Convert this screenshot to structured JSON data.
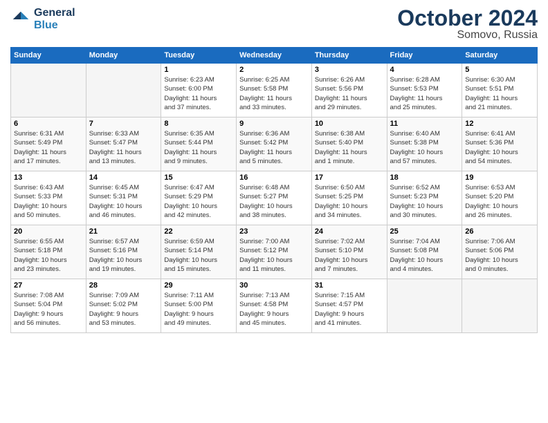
{
  "logo": {
    "line1": "General",
    "line2": "Blue"
  },
  "title": "October 2024",
  "location": "Somovo, Russia",
  "headers": [
    "Sunday",
    "Monday",
    "Tuesday",
    "Wednesday",
    "Thursday",
    "Friday",
    "Saturday"
  ],
  "weeks": [
    [
      {
        "day": "",
        "info": ""
      },
      {
        "day": "",
        "info": ""
      },
      {
        "day": "1",
        "info": "Sunrise: 6:23 AM\nSunset: 6:00 PM\nDaylight: 11 hours\nand 37 minutes."
      },
      {
        "day": "2",
        "info": "Sunrise: 6:25 AM\nSunset: 5:58 PM\nDaylight: 11 hours\nand 33 minutes."
      },
      {
        "day": "3",
        "info": "Sunrise: 6:26 AM\nSunset: 5:56 PM\nDaylight: 11 hours\nand 29 minutes."
      },
      {
        "day": "4",
        "info": "Sunrise: 6:28 AM\nSunset: 5:53 PM\nDaylight: 11 hours\nand 25 minutes."
      },
      {
        "day": "5",
        "info": "Sunrise: 6:30 AM\nSunset: 5:51 PM\nDaylight: 11 hours\nand 21 minutes."
      }
    ],
    [
      {
        "day": "6",
        "info": "Sunrise: 6:31 AM\nSunset: 5:49 PM\nDaylight: 11 hours\nand 17 minutes."
      },
      {
        "day": "7",
        "info": "Sunrise: 6:33 AM\nSunset: 5:47 PM\nDaylight: 11 hours\nand 13 minutes."
      },
      {
        "day": "8",
        "info": "Sunrise: 6:35 AM\nSunset: 5:44 PM\nDaylight: 11 hours\nand 9 minutes."
      },
      {
        "day": "9",
        "info": "Sunrise: 6:36 AM\nSunset: 5:42 PM\nDaylight: 11 hours\nand 5 minutes."
      },
      {
        "day": "10",
        "info": "Sunrise: 6:38 AM\nSunset: 5:40 PM\nDaylight: 11 hours\nand 1 minute."
      },
      {
        "day": "11",
        "info": "Sunrise: 6:40 AM\nSunset: 5:38 PM\nDaylight: 10 hours\nand 57 minutes."
      },
      {
        "day": "12",
        "info": "Sunrise: 6:41 AM\nSunset: 5:36 PM\nDaylight: 10 hours\nand 54 minutes."
      }
    ],
    [
      {
        "day": "13",
        "info": "Sunrise: 6:43 AM\nSunset: 5:33 PM\nDaylight: 10 hours\nand 50 minutes."
      },
      {
        "day": "14",
        "info": "Sunrise: 6:45 AM\nSunset: 5:31 PM\nDaylight: 10 hours\nand 46 minutes."
      },
      {
        "day": "15",
        "info": "Sunrise: 6:47 AM\nSunset: 5:29 PM\nDaylight: 10 hours\nand 42 minutes."
      },
      {
        "day": "16",
        "info": "Sunrise: 6:48 AM\nSunset: 5:27 PM\nDaylight: 10 hours\nand 38 minutes."
      },
      {
        "day": "17",
        "info": "Sunrise: 6:50 AM\nSunset: 5:25 PM\nDaylight: 10 hours\nand 34 minutes."
      },
      {
        "day": "18",
        "info": "Sunrise: 6:52 AM\nSunset: 5:23 PM\nDaylight: 10 hours\nand 30 minutes."
      },
      {
        "day": "19",
        "info": "Sunrise: 6:53 AM\nSunset: 5:20 PM\nDaylight: 10 hours\nand 26 minutes."
      }
    ],
    [
      {
        "day": "20",
        "info": "Sunrise: 6:55 AM\nSunset: 5:18 PM\nDaylight: 10 hours\nand 23 minutes."
      },
      {
        "day": "21",
        "info": "Sunrise: 6:57 AM\nSunset: 5:16 PM\nDaylight: 10 hours\nand 19 minutes."
      },
      {
        "day": "22",
        "info": "Sunrise: 6:59 AM\nSunset: 5:14 PM\nDaylight: 10 hours\nand 15 minutes."
      },
      {
        "day": "23",
        "info": "Sunrise: 7:00 AM\nSunset: 5:12 PM\nDaylight: 10 hours\nand 11 minutes."
      },
      {
        "day": "24",
        "info": "Sunrise: 7:02 AM\nSunset: 5:10 PM\nDaylight: 10 hours\nand 7 minutes."
      },
      {
        "day": "25",
        "info": "Sunrise: 7:04 AM\nSunset: 5:08 PM\nDaylight: 10 hours\nand 4 minutes."
      },
      {
        "day": "26",
        "info": "Sunrise: 7:06 AM\nSunset: 5:06 PM\nDaylight: 10 hours\nand 0 minutes."
      }
    ],
    [
      {
        "day": "27",
        "info": "Sunrise: 7:08 AM\nSunset: 5:04 PM\nDaylight: 9 hours\nand 56 minutes."
      },
      {
        "day": "28",
        "info": "Sunrise: 7:09 AM\nSunset: 5:02 PM\nDaylight: 9 hours\nand 53 minutes."
      },
      {
        "day": "29",
        "info": "Sunrise: 7:11 AM\nSunset: 5:00 PM\nDaylight: 9 hours\nand 49 minutes."
      },
      {
        "day": "30",
        "info": "Sunrise: 7:13 AM\nSunset: 4:58 PM\nDaylight: 9 hours\nand 45 minutes."
      },
      {
        "day": "31",
        "info": "Sunrise: 7:15 AM\nSunset: 4:57 PM\nDaylight: 9 hours\nand 41 minutes."
      },
      {
        "day": "",
        "info": ""
      },
      {
        "day": "",
        "info": ""
      }
    ]
  ]
}
